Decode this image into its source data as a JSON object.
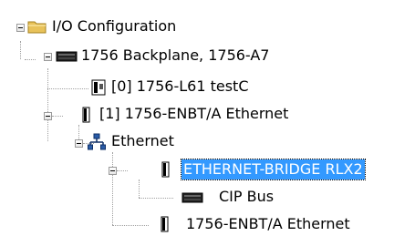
{
  "tree": {
    "nodes": [
      {
        "id": "io-config",
        "label": "I/O Configuration",
        "icon": "folder-icon",
        "expanded": true
      },
      {
        "id": "backplane",
        "label": "1756 Backplane, 1756-A7",
        "icon": "backplane-icon",
        "expanded": true
      },
      {
        "id": "controller",
        "label": "[0] 1756-L61 testC",
        "icon": "controller-module-icon"
      },
      {
        "id": "enbt-slot1",
        "label": "[1] 1756-ENBT/A Ethernet",
        "icon": "module-icon",
        "expanded": true
      },
      {
        "id": "ethernet",
        "label": "Ethernet",
        "icon": "network-icon",
        "expanded": true
      },
      {
        "id": "bridge",
        "label": "ETHERNET-BRIDGE RLX2",
        "icon": "module-icon",
        "expanded": true,
        "selected": true
      },
      {
        "id": "cip-bus",
        "label": "CIP Bus",
        "icon": "backplane-icon"
      },
      {
        "id": "enbt-remote",
        "label": "1756-ENBT/A Ethernet",
        "icon": "module-icon"
      }
    ]
  },
  "colors": {
    "selection_bg": "#3399ff",
    "selection_text": "#ffffff",
    "folder": "#e8c25a",
    "network": "#2a5ca8"
  }
}
